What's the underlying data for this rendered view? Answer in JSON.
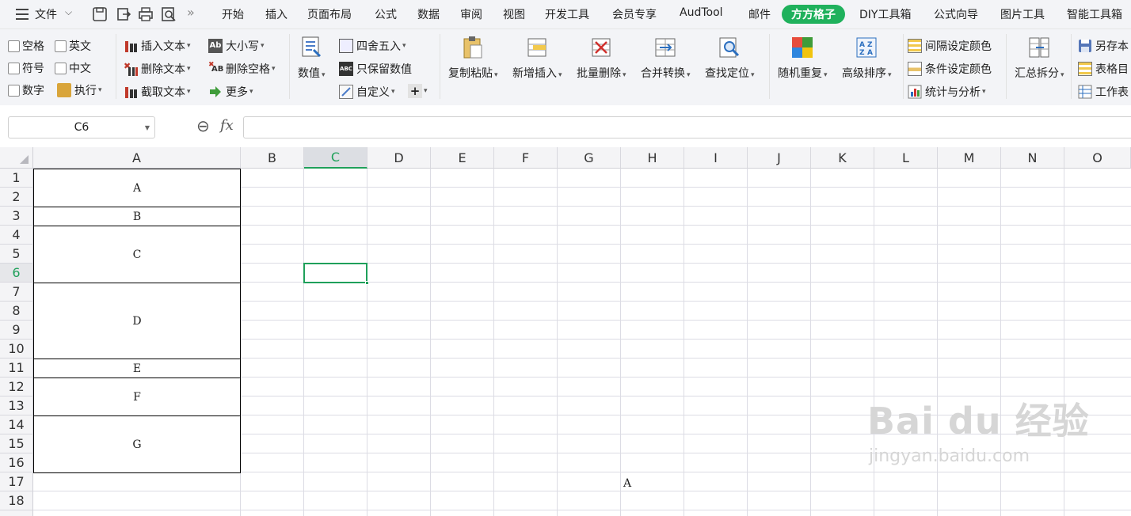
{
  "menu": {
    "file_label": "文件",
    "more_glyph": "»",
    "tabs": [
      "开始",
      "插入",
      "页面布局",
      "公式",
      "数据",
      "审阅",
      "视图",
      "开发工具",
      "会员专享",
      "AudTool",
      "邮件",
      "方方格子",
      "DIY工具箱",
      "公式向导",
      "图片工具",
      "智能工具箱"
    ],
    "active_tab": "方方格子"
  },
  "ribbon": {
    "checks": [
      "空格",
      "英文",
      "符号",
      "中文",
      "数字"
    ],
    "execute": "执行",
    "text_ops": [
      "插入文本",
      "删除文本",
      "截取文本"
    ],
    "case_ops": [
      "大小写",
      "删除空格",
      "更多"
    ],
    "numeric": "数值",
    "round_ops": [
      "四舍五入",
      "只保留数值",
      "自定义"
    ],
    "plus_glyph": "+",
    "big_buttons": [
      "复制粘贴",
      "新增插入",
      "批量删除",
      "合并转换",
      "查找定位"
    ],
    "random": "随机重复",
    "sort": "高级排序",
    "color_ops": [
      "间隔设定颜色",
      "条件设定颜色",
      "统计与分析"
    ],
    "summary": "汇总拆分",
    "right_ops": [
      "另存本",
      "表格目",
      "工作表"
    ]
  },
  "formula_bar": {
    "cell_ref": "C6",
    "fx": "fx",
    "zoom_glyph": "⊖",
    "value": ""
  },
  "sheet": {
    "columns": [
      "A",
      "B",
      "C",
      "D",
      "E",
      "F",
      "G",
      "H",
      "I",
      "J",
      "K",
      "L",
      "M",
      "N",
      "O"
    ],
    "selected_column": "C",
    "rows": [
      "1",
      "2",
      "3",
      "4",
      "5",
      "6",
      "7",
      "8",
      "9",
      "10",
      "11",
      "12",
      "13",
      "14",
      "15",
      "16",
      "17",
      "18"
    ],
    "selected_row": "6",
    "merged_cells": [
      "A",
      "B",
      "C",
      "D",
      "E",
      "F",
      "G"
    ],
    "cell_h17": "A"
  },
  "watermark": {
    "brand": "Bai du 经验",
    "url": "jingyan.baidu.com"
  },
  "colors": {
    "accent": "#1fb15c",
    "selection": "#1fa05a"
  }
}
